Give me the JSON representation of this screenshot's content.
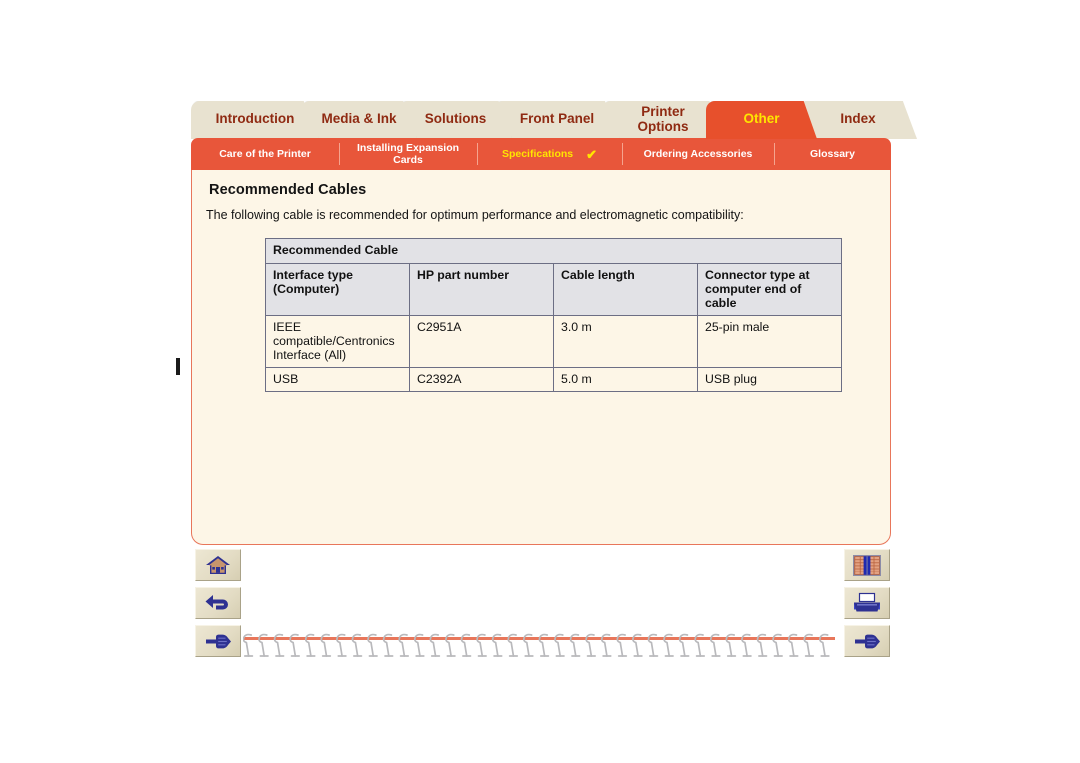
{
  "document": {
    "title": "Recommended Cables",
    "intro": "The following cable is recommended for optimum performance and electromagnetic compatibility:"
  },
  "colors": {
    "active_tab_bg": "#E7502C",
    "active_tab_text": "#FFE500",
    "inactive_tab_bg": "#E8E2D0",
    "inactive_tab_text": "#8F2A12",
    "subbar_bg": "#E8563A",
    "panel_bg": "#FDF6E7",
    "panel_border": "#E8765A",
    "table_header_bg": "#E2E2E6",
    "table_border": "#6C6E84"
  },
  "main_tabs": [
    {
      "label": "Introduction",
      "active": false,
      "lines": [
        "Introduction"
      ]
    },
    {
      "label": "Media & Ink",
      "active": false,
      "lines": [
        "Media & Ink"
      ]
    },
    {
      "label": "Solutions",
      "active": false,
      "lines": [
        "Solutions"
      ]
    },
    {
      "label": "Front Panel",
      "active": false,
      "lines": [
        "Front Panel"
      ]
    },
    {
      "label": "Printer Options",
      "active": false,
      "lines": [
        "Printer",
        "Options"
      ]
    },
    {
      "label": "Other",
      "active": true,
      "lines": [
        "Other"
      ]
    },
    {
      "label": "Index",
      "active": false,
      "lines": [
        "Index"
      ]
    }
  ],
  "sub_tabs": [
    {
      "label": "Care of the Printer",
      "selected": false,
      "lines": [
        "Care of the Printer"
      ]
    },
    {
      "label": "Installing Expansion Cards",
      "selected": false,
      "lines": [
        "Installing Expansion",
        "Cards"
      ]
    },
    {
      "label": "Specifications",
      "selected": true,
      "lines": [
        "Specifications"
      ],
      "check": "✔"
    },
    {
      "label": "Ordering Accessories",
      "selected": false,
      "lines": [
        "Ordering Accessories"
      ]
    },
    {
      "label": "Glossary",
      "selected": false,
      "lines": [
        "Glossary"
      ]
    }
  ],
  "table": {
    "caption": "Recommended Cable",
    "columns": [
      "Interface type (Computer)",
      "HP part number",
      "Cable length",
      "Connector type at computer end of cable"
    ],
    "rows": [
      {
        "interface": "IEEE compatible/Centronics Interface (All)",
        "part_number": "C2951A",
        "length": "3.0 m",
        "connector": "25-pin male"
      },
      {
        "interface": "USB",
        "part_number": "C2392A",
        "length": "5.0 m",
        "connector": "USB plug"
      }
    ]
  },
  "nav_left": [
    {
      "name": "home-icon",
      "tip": "Home"
    },
    {
      "name": "back-icon",
      "tip": "Back"
    },
    {
      "name": "next-icon",
      "tip": "Next"
    }
  ],
  "nav_right": [
    {
      "name": "bookshelf-icon",
      "tip": "Contents"
    },
    {
      "name": "printer-icon",
      "tip": "Print"
    },
    {
      "name": "forward-icon",
      "tip": "Forward"
    }
  ]
}
